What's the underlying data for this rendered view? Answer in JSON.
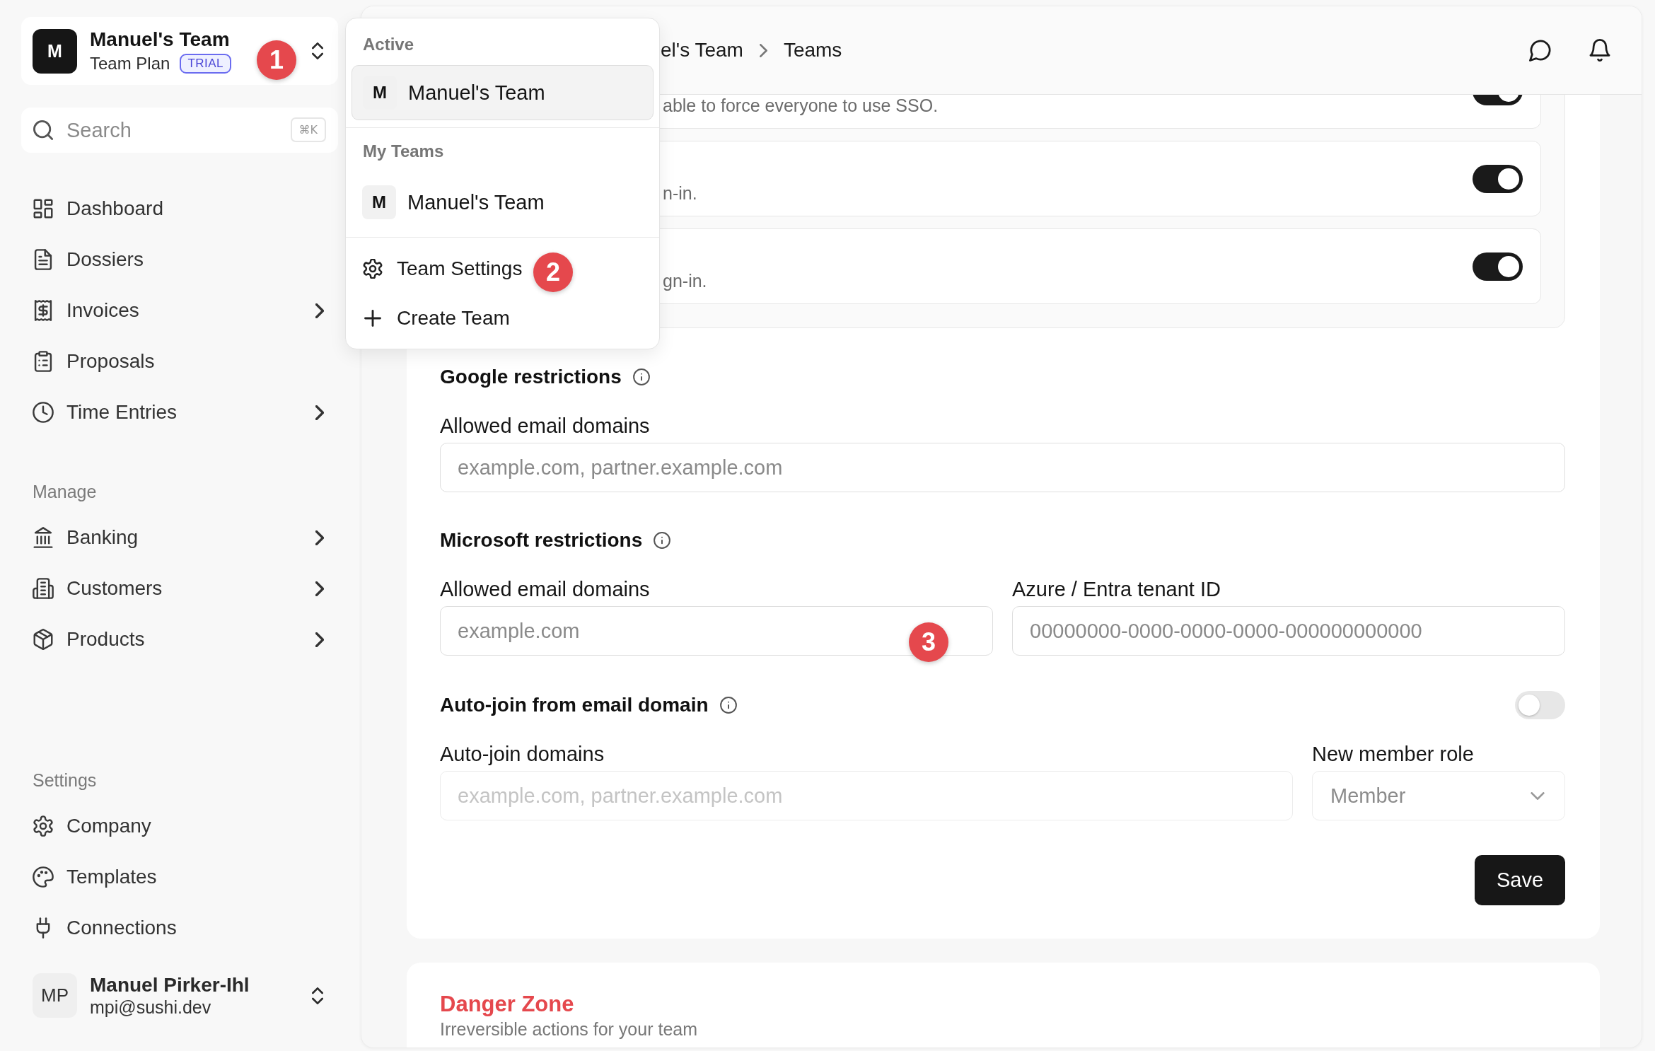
{
  "team_switcher": {
    "avatar": "M",
    "name": "Manuel's Team",
    "plan": "Team Plan",
    "badge": "TRIAL",
    "marker": "1"
  },
  "search": {
    "placeholder": "Search",
    "shortcut": "⌘K"
  },
  "sidebar": {
    "groups": [
      {
        "items": [
          {
            "label": "Dashboard",
            "expandable": false,
            "selected": false
          },
          {
            "label": "Dossiers",
            "expandable": false,
            "selected": false
          },
          {
            "label": "Invoices",
            "expandable": true,
            "selected": false
          },
          {
            "label": "Proposals",
            "expandable": false,
            "selected": false
          },
          {
            "label": "Time Entries",
            "expandable": true,
            "selected": false
          }
        ]
      },
      {
        "title": "Manage",
        "items": [
          {
            "label": "Banking",
            "expandable": true,
            "selected": false
          },
          {
            "label": "Customers",
            "expandable": true,
            "selected": false
          },
          {
            "label": "Products",
            "expandable": true,
            "selected": false
          }
        ]
      },
      {
        "title": "Settings",
        "items": [
          {
            "label": "Company",
            "expandable": false,
            "selected": false
          },
          {
            "label": "Templates",
            "expandable": false,
            "selected": false
          },
          {
            "label": "Connections",
            "expandable": false,
            "selected": false
          }
        ]
      }
    ]
  },
  "user": {
    "initials": "MP",
    "name": "Manuel Pirker-Ihl",
    "email": "mpi@sushi.dev"
  },
  "team_menu": {
    "sections": [
      {
        "title": "Active",
        "teams": [
          {
            "avatar": "M",
            "name": "Manuel's Team",
            "selected": true
          }
        ]
      },
      {
        "title": "My Teams",
        "teams": [
          {
            "avatar": "M",
            "name": "Manuel's Team",
            "selected": false
          }
        ]
      }
    ],
    "actions": [
      {
        "label": "Team Settings",
        "marker": "2"
      },
      {
        "label": "Create Team"
      }
    ]
  },
  "header": {
    "breadcrumb": [
      "el's Team",
      "Teams"
    ]
  },
  "sso_options": [
    {
      "description": "able to force everyone to use SSO.",
      "on": true
    },
    {
      "description": "n-in.",
      "on": true
    },
    {
      "description": "gn-in.",
      "on": true
    }
  ],
  "sections": [
    {
      "kind": "fields",
      "title": "Google restrictions",
      "fields": [
        {
          "kind": "text",
          "label": "Allowed email domains",
          "placeholder": "example.com, partner.example.com",
          "disabled": false
        }
      ]
    },
    {
      "kind": "fields",
      "title": "Microsoft restrictions",
      "fields": [
        {
          "kind": "text",
          "label": "Allowed email domains",
          "placeholder": "example.com",
          "disabled": false,
          "marker": "3"
        },
        {
          "kind": "text",
          "label": "Azure / Entra tenant ID",
          "placeholder": "00000000-0000-0000-0000-000000000000",
          "disabled": false
        }
      ]
    },
    {
      "kind": "toggle",
      "title": "Auto-join from email domain",
      "on": false,
      "fields": [
        {
          "kind": "text",
          "label": "Auto-join domains",
          "placeholder": "example.com, partner.example.com",
          "disabled": true
        },
        {
          "kind": "select",
          "label": "New member role",
          "value": "Member",
          "disabled": true
        }
      ]
    }
  ],
  "save_button": "Save",
  "danger_zone": {
    "title": "Danger Zone",
    "description": "Irreversible actions for your team"
  }
}
